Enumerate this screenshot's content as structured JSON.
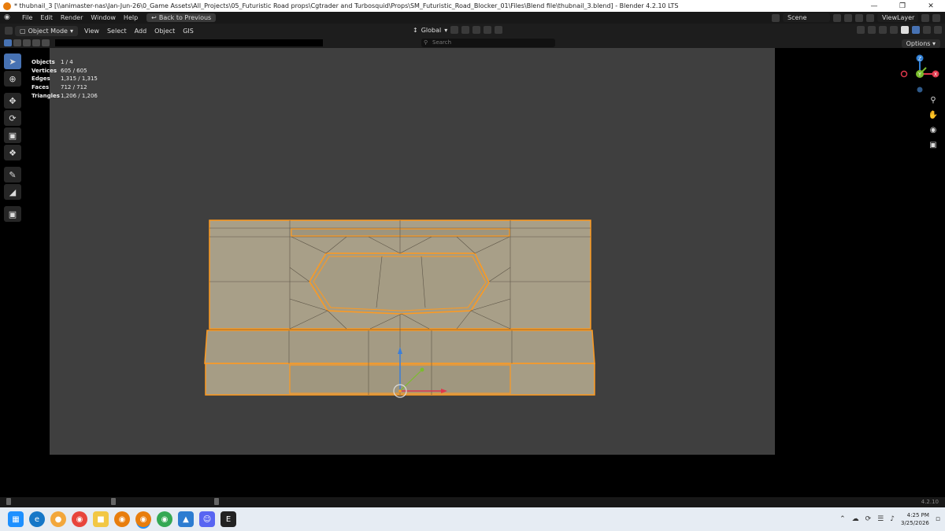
{
  "window": {
    "title": "* thubnail_3 [\\\\animaster-nas\\Jan-Jun-26\\0_Game Assets\\All_Projects\\05_Futuristic Road props\\Cgtrader and Turbosquid\\Props\\SM_Futuristic_Road_Blocker_01\\Files\\Blend file\\thubnail_3.blend] - Blender 4.2.10 LTS",
    "minimize": "—",
    "maximize": "❐",
    "close": "✕"
  },
  "menu": {
    "items": [
      "File",
      "Edit",
      "Render",
      "Window",
      "Help"
    ],
    "back_label": "Back to Previous",
    "scene_label": "Scene",
    "viewlayer_label": "ViewLayer"
  },
  "header": {
    "mode": "Object Mode",
    "items": [
      "View",
      "Select",
      "Add",
      "Object",
      "GIS"
    ],
    "orientation": "Global",
    "search_placeholder": "Search",
    "options_label": "Options"
  },
  "stats": [
    {
      "label": "Objects",
      "value": "1 / 4"
    },
    {
      "label": "Vertices",
      "value": "605 / 605"
    },
    {
      "label": "Edges",
      "value": "1,315 / 1,315"
    },
    {
      "label": "Faces",
      "value": "712 / 712"
    },
    {
      "label": "Triangles",
      "value": "1,206 / 1,206"
    }
  ],
  "gizmo": {
    "x_label": "X",
    "y_label": "Y",
    "z_label": "Z",
    "x_color": "#e0384c",
    "y_color": "#7bbd2c",
    "z_color": "#2f7fd5"
  },
  "status": {
    "version": "4.2.10"
  },
  "taskbar": {
    "time": "4:25 PM",
    "date": "3/25/2026"
  },
  "colors": {
    "accent": "#4772b3",
    "selection": "#ff9a1f",
    "mesh": "#a69d85"
  }
}
